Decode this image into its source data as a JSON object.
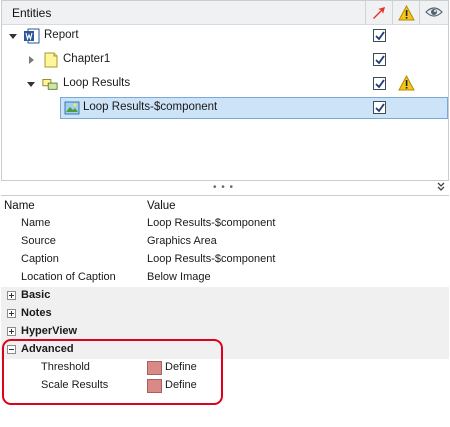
{
  "entities": {
    "title": "Entities",
    "columns": [
      {
        "icon": "red-arrow-icon"
      },
      {
        "icon": "warning-icon"
      },
      {
        "icon": "eye-icon"
      }
    ],
    "tree": [
      {
        "label": "Report",
        "icon": "word-document-icon",
        "expanded": true,
        "checked": true,
        "warning": false
      },
      {
        "label": "Chapter1",
        "icon": "chapter-page-icon",
        "expanded": false,
        "checked": true,
        "warning": false
      },
      {
        "label": "Loop Results",
        "icon": "loop-results-icon",
        "expanded": true,
        "checked": true,
        "warning": true
      },
      {
        "label": "Loop Results-$component",
        "icon": "image-icon",
        "selected": true,
        "checked": true,
        "warning": false
      }
    ]
  },
  "splitter": {
    "grip": "• • •",
    "collapse_icon": "double-chevron-down-icon"
  },
  "properties": {
    "headers": {
      "name": "Name",
      "value": "Value"
    },
    "rows": [
      {
        "name": "Name",
        "value": "Loop Results-$component"
      },
      {
        "name": "Source",
        "value": "Graphics Area"
      },
      {
        "name": "Caption",
        "value": "Loop Results-$component"
      },
      {
        "name": "Location of Caption",
        "value": "Below Image"
      }
    ],
    "groups": [
      {
        "label": "Basic",
        "expanded": false
      },
      {
        "label": "Notes",
        "expanded": false
      },
      {
        "label": "HyperView",
        "expanded": false
      },
      {
        "label": "Advanced",
        "expanded": true
      }
    ],
    "advanced_rows": [
      {
        "name": "Threshold",
        "value": "Define",
        "swatch_color": "#d98a86"
      },
      {
        "name": "Scale Results",
        "value": "Define",
        "swatch_color": "#d98a86"
      }
    ]
  },
  "colors": {
    "highlight": "#e0001b",
    "selection": "#cde3f7"
  }
}
